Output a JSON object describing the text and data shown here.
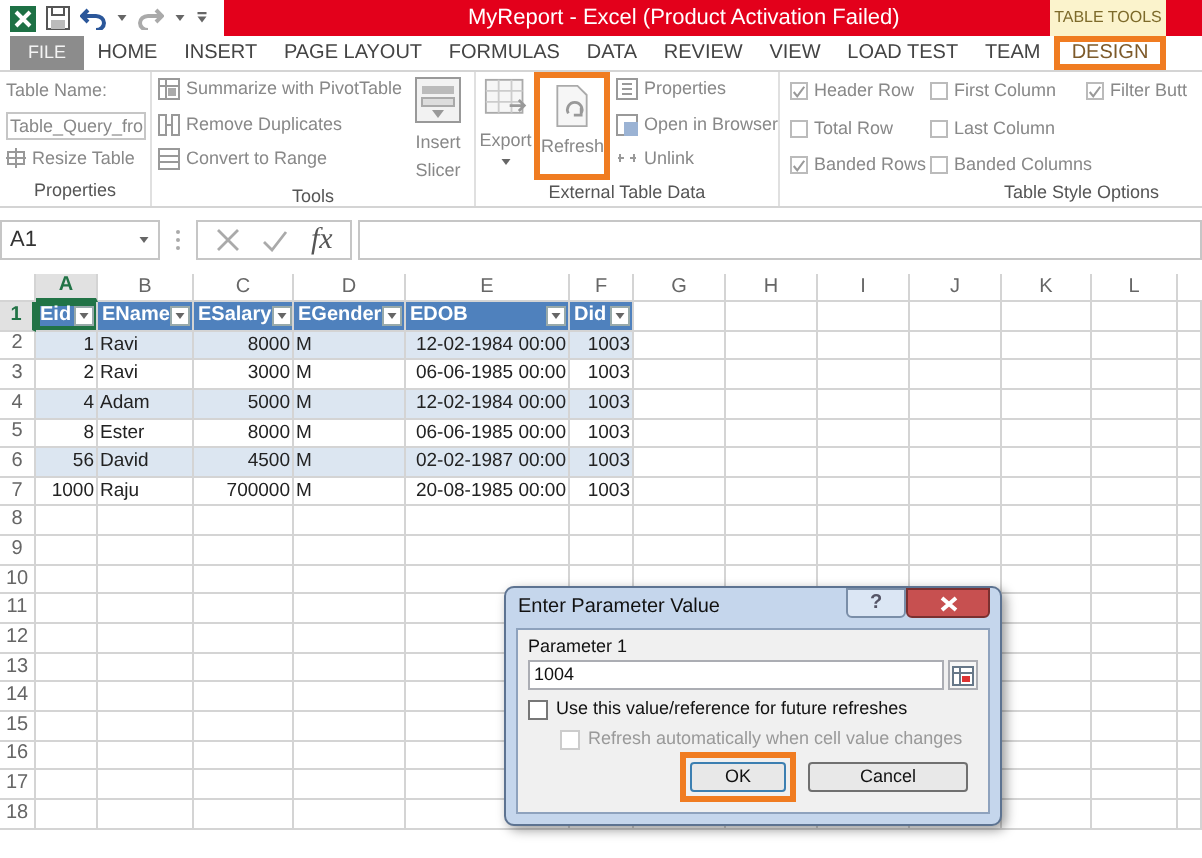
{
  "title_bar": {
    "title": "MyReport -  Excel (Product Activation Failed)",
    "contextual_tab": "TABLE TOOLS"
  },
  "ribbon_tabs": [
    {
      "label": "FILE",
      "kind": "backstage",
      "selected": false,
      "highlighted": false
    },
    {
      "label": "HOME",
      "kind": "tab",
      "selected": false,
      "highlighted": false
    },
    {
      "label": "INSERT",
      "kind": "tab",
      "selected": false,
      "highlighted": false
    },
    {
      "label": "PAGE LAYOUT",
      "kind": "tab",
      "selected": false,
      "highlighted": false
    },
    {
      "label": "FORMULAS",
      "kind": "tab",
      "selected": false,
      "highlighted": false
    },
    {
      "label": "DATA",
      "kind": "tab",
      "selected": false,
      "highlighted": false
    },
    {
      "label": "REVIEW",
      "kind": "tab",
      "selected": false,
      "highlighted": false
    },
    {
      "label": "VIEW",
      "kind": "tab",
      "selected": false,
      "highlighted": false
    },
    {
      "label": "LOAD TEST",
      "kind": "tab",
      "selected": false,
      "highlighted": false
    },
    {
      "label": "TEAM",
      "kind": "tab",
      "selected": false,
      "highlighted": false
    },
    {
      "label": "DESIGN",
      "kind": "tab",
      "selected": true,
      "highlighted": true
    }
  ],
  "ribbon": {
    "properties": {
      "label": "Properties",
      "name_label": "Table Name:",
      "name_value": "Table_Query_fro",
      "resize": "Resize Table"
    },
    "tools": {
      "label": "Tools",
      "commands": [
        "Summarize with PivotTable",
        "Remove Duplicates",
        "Convert to Range"
      ],
      "large_button": "Insert Slicer"
    },
    "external": {
      "label": "External Table Data",
      "large_buttons": [
        {
          "label": "Export",
          "highlighted": false
        },
        {
          "label": "Refresh",
          "highlighted": true
        }
      ],
      "commands": [
        "Properties",
        "Open in Browser",
        "Unlink"
      ]
    },
    "style_options": {
      "label": "Table Style Options",
      "columns": [
        [
          {
            "label": "Header Row",
            "checked": true
          },
          {
            "label": "Total Row",
            "checked": false
          },
          {
            "label": "Banded Rows",
            "checked": true
          }
        ],
        [
          {
            "label": "First Column",
            "checked": false
          },
          {
            "label": "Last Column",
            "checked": false
          },
          {
            "label": "Banded Columns",
            "checked": false
          }
        ],
        [
          {
            "label": "Filter Butt",
            "checked": true
          }
        ]
      ]
    }
  },
  "formula_bar": {
    "name_box": "A1",
    "function_button": "fx"
  },
  "sheet": {
    "columns": [
      {
        "label": "A",
        "selected": true
      },
      {
        "label": "B",
        "selected": false
      },
      {
        "label": "C",
        "selected": false
      },
      {
        "label": "D",
        "selected": false
      },
      {
        "label": "E",
        "selected": false
      },
      {
        "label": "F",
        "selected": false
      },
      {
        "label": "G",
        "selected": false
      },
      {
        "label": "H",
        "selected": false
      },
      {
        "label": "I",
        "selected": false
      },
      {
        "label": "J",
        "selected": false
      },
      {
        "label": "K",
        "selected": false
      },
      {
        "label": "L",
        "selected": false
      }
    ],
    "rows": [
      {
        "label": "1",
        "selected": true
      },
      {
        "label": "2",
        "selected": false
      },
      {
        "label": "3",
        "selected": false
      },
      {
        "label": "4",
        "selected": false
      },
      {
        "label": "5",
        "selected": false
      },
      {
        "label": "6",
        "selected": false
      },
      {
        "label": "7",
        "selected": false
      },
      {
        "label": "8",
        "selected": false
      },
      {
        "label": "9",
        "selected": false
      },
      {
        "label": "10",
        "selected": false
      },
      {
        "label": "11",
        "selected": false
      },
      {
        "label": "12",
        "selected": false
      },
      {
        "label": "13",
        "selected": false
      },
      {
        "label": "14",
        "selected": false
      },
      {
        "label": "15",
        "selected": false
      },
      {
        "label": "16",
        "selected": false
      },
      {
        "label": "17",
        "selected": false
      },
      {
        "label": "18",
        "selected": false
      }
    ],
    "table": {
      "headers": [
        "Eid",
        "EName",
        "ESalary",
        "EGender",
        "EDOB",
        "Did"
      ],
      "rows": [
        [
          "1",
          "Ravi",
          "8000",
          "M",
          "12-02-1984 00:00",
          "1003"
        ],
        [
          "2",
          "Ravi",
          "3000",
          "M",
          "06-06-1985 00:00",
          "1003"
        ],
        [
          "4",
          "Adam",
          "5000",
          "M",
          "12-02-1984 00:00",
          "1003"
        ],
        [
          "8",
          "Ester",
          "8000",
          "M",
          "06-06-1985 00:00",
          "1003"
        ],
        [
          "56",
          "David",
          "4500",
          "M",
          "02-02-1987 00:00",
          "1003"
        ],
        [
          "1000",
          "Raju",
          "700000",
          "M",
          "20-08-1985 00:00",
          "1003"
        ]
      ]
    }
  },
  "dialog": {
    "title": "Enter Parameter Value",
    "help_button": "?",
    "parameter_label": "Parameter 1",
    "value": "1004",
    "options": [
      {
        "label": "Use this value/reference for future refreshes",
        "checked": false,
        "disabled": false
      },
      {
        "label": "Refresh automatically when cell value changes",
        "checked": false,
        "disabled": true
      }
    ],
    "buttons": [
      {
        "label": "OK",
        "highlighted": true
      },
      {
        "label": "Cancel",
        "highlighted": false
      }
    ]
  }
}
